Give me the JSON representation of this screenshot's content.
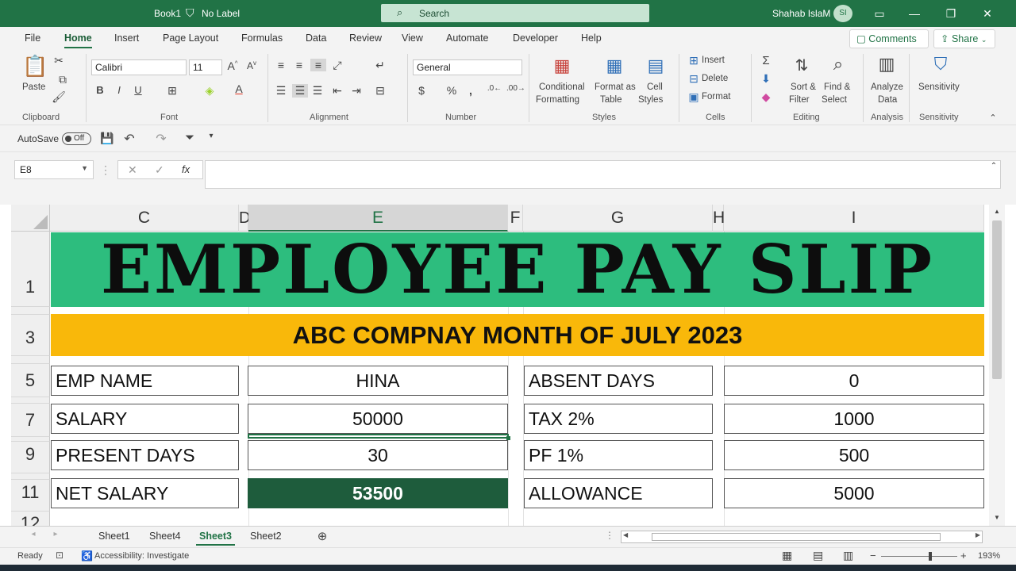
{
  "titlebar": {
    "doc_name": "Book1",
    "label_status": "No Label",
    "search_placeholder": "Search",
    "user_name": "Shahab IslaM",
    "user_initials": "SI"
  },
  "menu": {
    "tabs": [
      "File",
      "Home",
      "Insert",
      "Page Layout",
      "Formulas",
      "Data",
      "Review",
      "View",
      "Automate",
      "Developer",
      "Help"
    ],
    "active": "Home",
    "comments_label": "Comments",
    "share_label": "Share"
  },
  "ribbon": {
    "clipboard": {
      "paste": "Paste",
      "label": "Clipboard"
    },
    "font": {
      "name": "Calibri",
      "size": "11",
      "label": "Font"
    },
    "alignment": {
      "label": "Alignment"
    },
    "number": {
      "format": "General",
      "label": "Number"
    },
    "styles": {
      "conditional_1": "Conditional",
      "conditional_2": "Formatting",
      "format_table_1": "Format as",
      "format_table_2": "Table",
      "cell_styles_1": "Cell",
      "cell_styles_2": "Styles",
      "label": "Styles"
    },
    "cells": {
      "insert": "Insert",
      "delete": "Delete",
      "format": "Format",
      "label": "Cells"
    },
    "editing": {
      "sort_1": "Sort &",
      "sort_2": "Filter",
      "find_1": "Find &",
      "find_2": "Select",
      "label": "Editing"
    },
    "analysis": {
      "analyze_1": "Analyze",
      "analyze_2": "Data",
      "label": "Analysis"
    },
    "sensitivity": {
      "btn": "Sensitivity",
      "label": "Sensitivity"
    }
  },
  "qat": {
    "autosave": "AutoSave",
    "toggle": "Off"
  },
  "formula_bar": {
    "cell_ref": "E8",
    "formula": ""
  },
  "sheet": {
    "columns": [
      "C",
      "D",
      "E",
      "F",
      "G",
      "H",
      "I"
    ],
    "selected_column": "E",
    "rows": [
      "1",
      "3",
      "5",
      "7",
      "9",
      "11",
      "12"
    ],
    "title": "EMPLOYEE PAY SLIP",
    "subtitle": "ABC COMPNAY MONTH OF JULY 2023",
    "fields": {
      "emp_name_label": "EMP NAME",
      "emp_name_value": "HINA",
      "salary_label": "SALARY",
      "salary_value": "50000",
      "present_label": "PRESENT DAYS",
      "present_value": "30",
      "net_label": "NET SALARY",
      "net_value": "53500",
      "absent_label": "ABSENT DAYS",
      "absent_value": "0",
      "tax_label": "TAX 2%",
      "tax_value": "1000",
      "pf_label": "PF 1%",
      "pf_value": "500",
      "allowance_label": "ALLOWANCE",
      "allowance_value": "5000"
    }
  },
  "sheet_tabs": {
    "tabs": [
      "Sheet1",
      "Sheet4",
      "Sheet3",
      "Sheet2"
    ],
    "active": "Sheet3"
  },
  "status": {
    "ready": "Ready",
    "accessibility": "Accessibility: Investigate",
    "zoom": "193%"
  },
  "colors": {
    "excel_green": "#217346",
    "banner_green": "#2dbd7e",
    "banner_yellow": "#f9b80a",
    "net_fill": "#1e5c3c"
  }
}
